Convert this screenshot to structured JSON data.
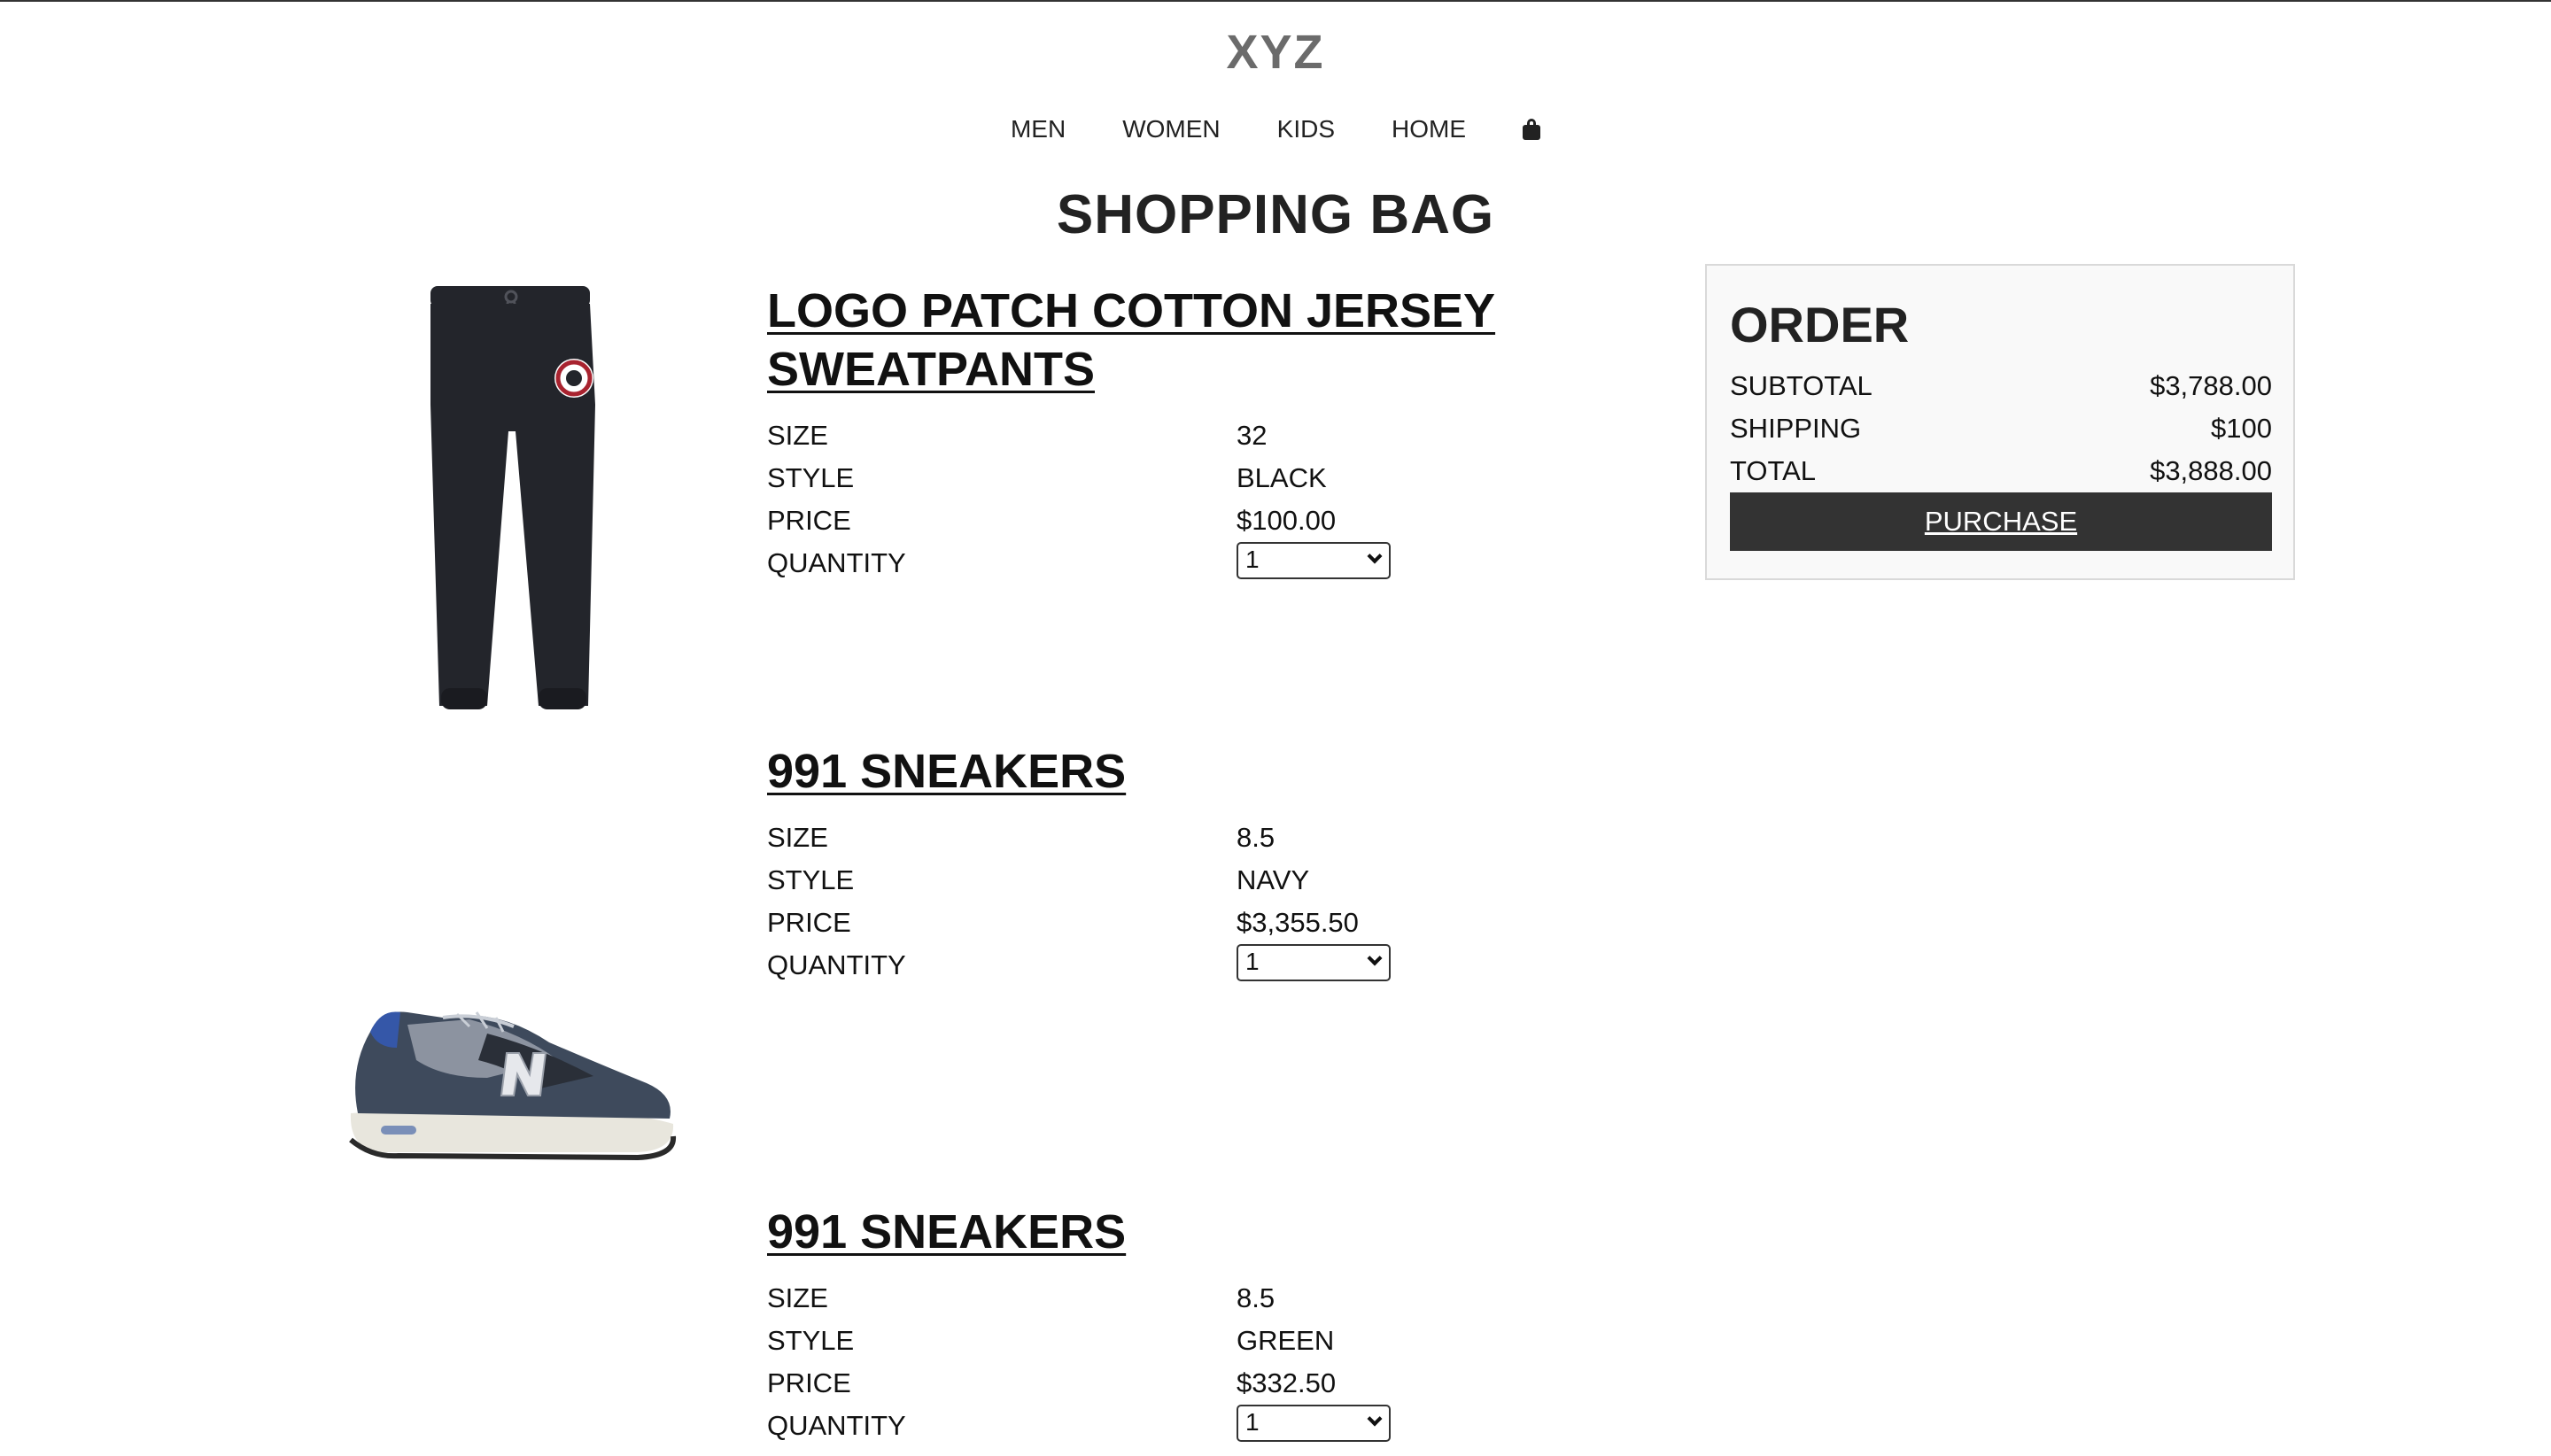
{
  "header": {
    "brand": "XYZ",
    "nav": [
      "MEN",
      "WOMEN",
      "KIDS",
      "HOME"
    ],
    "bag_icon": "shopping-bag-icon"
  },
  "page": {
    "title": "SHOPPING BAG"
  },
  "labels": {
    "size": "SIZE",
    "style": "STYLE",
    "price": "PRICE",
    "quantity": "QUANTITY"
  },
  "items": [
    {
      "title": "LOGO PATCH COTTON JERSEY SWEATPANTS",
      "size": "32",
      "style": "BLACK",
      "price": "$100.00",
      "quantity": "1",
      "image": "sweatpants-image"
    },
    {
      "title": "991 SNEAKERS",
      "size": "8.5",
      "style": "NAVY",
      "price": "$3,355.50",
      "quantity": "1",
      "image": "sneaker-image"
    },
    {
      "title": "991 SNEAKERS",
      "size": "8.5",
      "style": "GREEN",
      "price": "$332.50",
      "quantity": "1"
    }
  ],
  "order": {
    "title": "ORDER",
    "subtotal_label": "SUBTOTAL",
    "subtotal": "$3,788.00",
    "shipping_label": "SHIPPING",
    "shipping": "$100",
    "total_label": "TOTAL",
    "total": "$3,888.00",
    "purchase_label": "PURCHASE"
  },
  "colors": {
    "button_bg": "#333333",
    "order_box_bg": "#f9f9f9",
    "brand": "#6b6b6b"
  }
}
